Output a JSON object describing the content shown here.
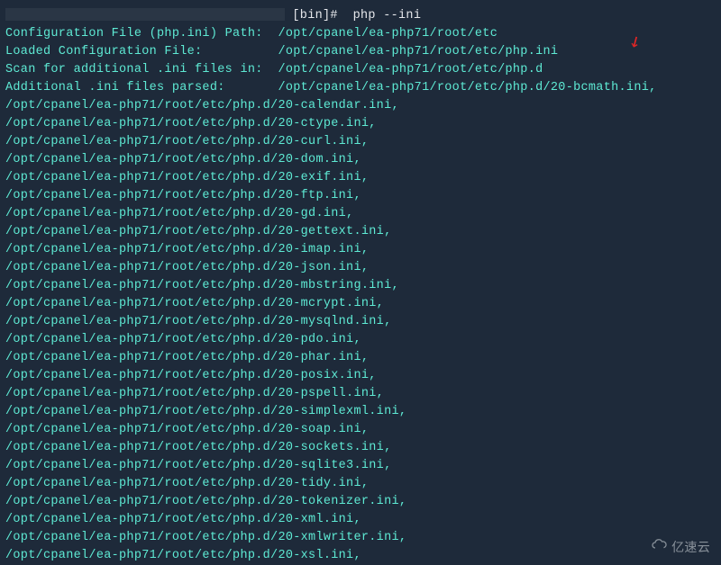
{
  "prompt": {
    "suffix": " [bin]#  php --ini"
  },
  "header": {
    "config_path_label": "Configuration File (php.ini) Path:  ",
    "config_path_value": "/opt/cpanel/ea-php71/root/etc",
    "loaded_label": "Loaded Configuration File:          ",
    "loaded_value": "/opt/cpanel/ea-php71/root/etc/php.ini",
    "scan_label": "Scan for additional .ini files in:  ",
    "scan_value": "/opt/cpanel/ea-php71/root/etc/php.d",
    "additional_label": "Additional .ini files parsed:       ",
    "additional_value": "/opt/cpanel/ea-php71/root/etc/php.d/20-bcmath.ini,"
  },
  "ini_files": [
    "/opt/cpanel/ea-php71/root/etc/php.d/20-calendar.ini,",
    "/opt/cpanel/ea-php71/root/etc/php.d/20-ctype.ini,",
    "/opt/cpanel/ea-php71/root/etc/php.d/20-curl.ini,",
    "/opt/cpanel/ea-php71/root/etc/php.d/20-dom.ini,",
    "/opt/cpanel/ea-php71/root/etc/php.d/20-exif.ini,",
    "/opt/cpanel/ea-php71/root/etc/php.d/20-ftp.ini,",
    "/opt/cpanel/ea-php71/root/etc/php.d/20-gd.ini,",
    "/opt/cpanel/ea-php71/root/etc/php.d/20-gettext.ini,",
    "/opt/cpanel/ea-php71/root/etc/php.d/20-imap.ini,",
    "/opt/cpanel/ea-php71/root/etc/php.d/20-json.ini,",
    "/opt/cpanel/ea-php71/root/etc/php.d/20-mbstring.ini,",
    "/opt/cpanel/ea-php71/root/etc/php.d/20-mcrypt.ini,",
    "/opt/cpanel/ea-php71/root/etc/php.d/20-mysqlnd.ini,",
    "/opt/cpanel/ea-php71/root/etc/php.d/20-pdo.ini,",
    "/opt/cpanel/ea-php71/root/etc/php.d/20-phar.ini,",
    "/opt/cpanel/ea-php71/root/etc/php.d/20-posix.ini,",
    "/opt/cpanel/ea-php71/root/etc/php.d/20-pspell.ini,",
    "/opt/cpanel/ea-php71/root/etc/php.d/20-simplexml.ini,",
    "/opt/cpanel/ea-php71/root/etc/php.d/20-soap.ini,",
    "/opt/cpanel/ea-php71/root/etc/php.d/20-sockets.ini,",
    "/opt/cpanel/ea-php71/root/etc/php.d/20-sqlite3.ini,",
    "/opt/cpanel/ea-php71/root/etc/php.d/20-tidy.ini,",
    "/opt/cpanel/ea-php71/root/etc/php.d/20-tokenizer.ini,",
    "/opt/cpanel/ea-php71/root/etc/php.d/20-xml.ini,",
    "/opt/cpanel/ea-php71/root/etc/php.d/20-xmlwriter.ini,",
    "/opt/cpanel/ea-php71/root/etc/php.d/20-xsl.ini,"
  ],
  "watermark": {
    "text": "亿速云"
  }
}
